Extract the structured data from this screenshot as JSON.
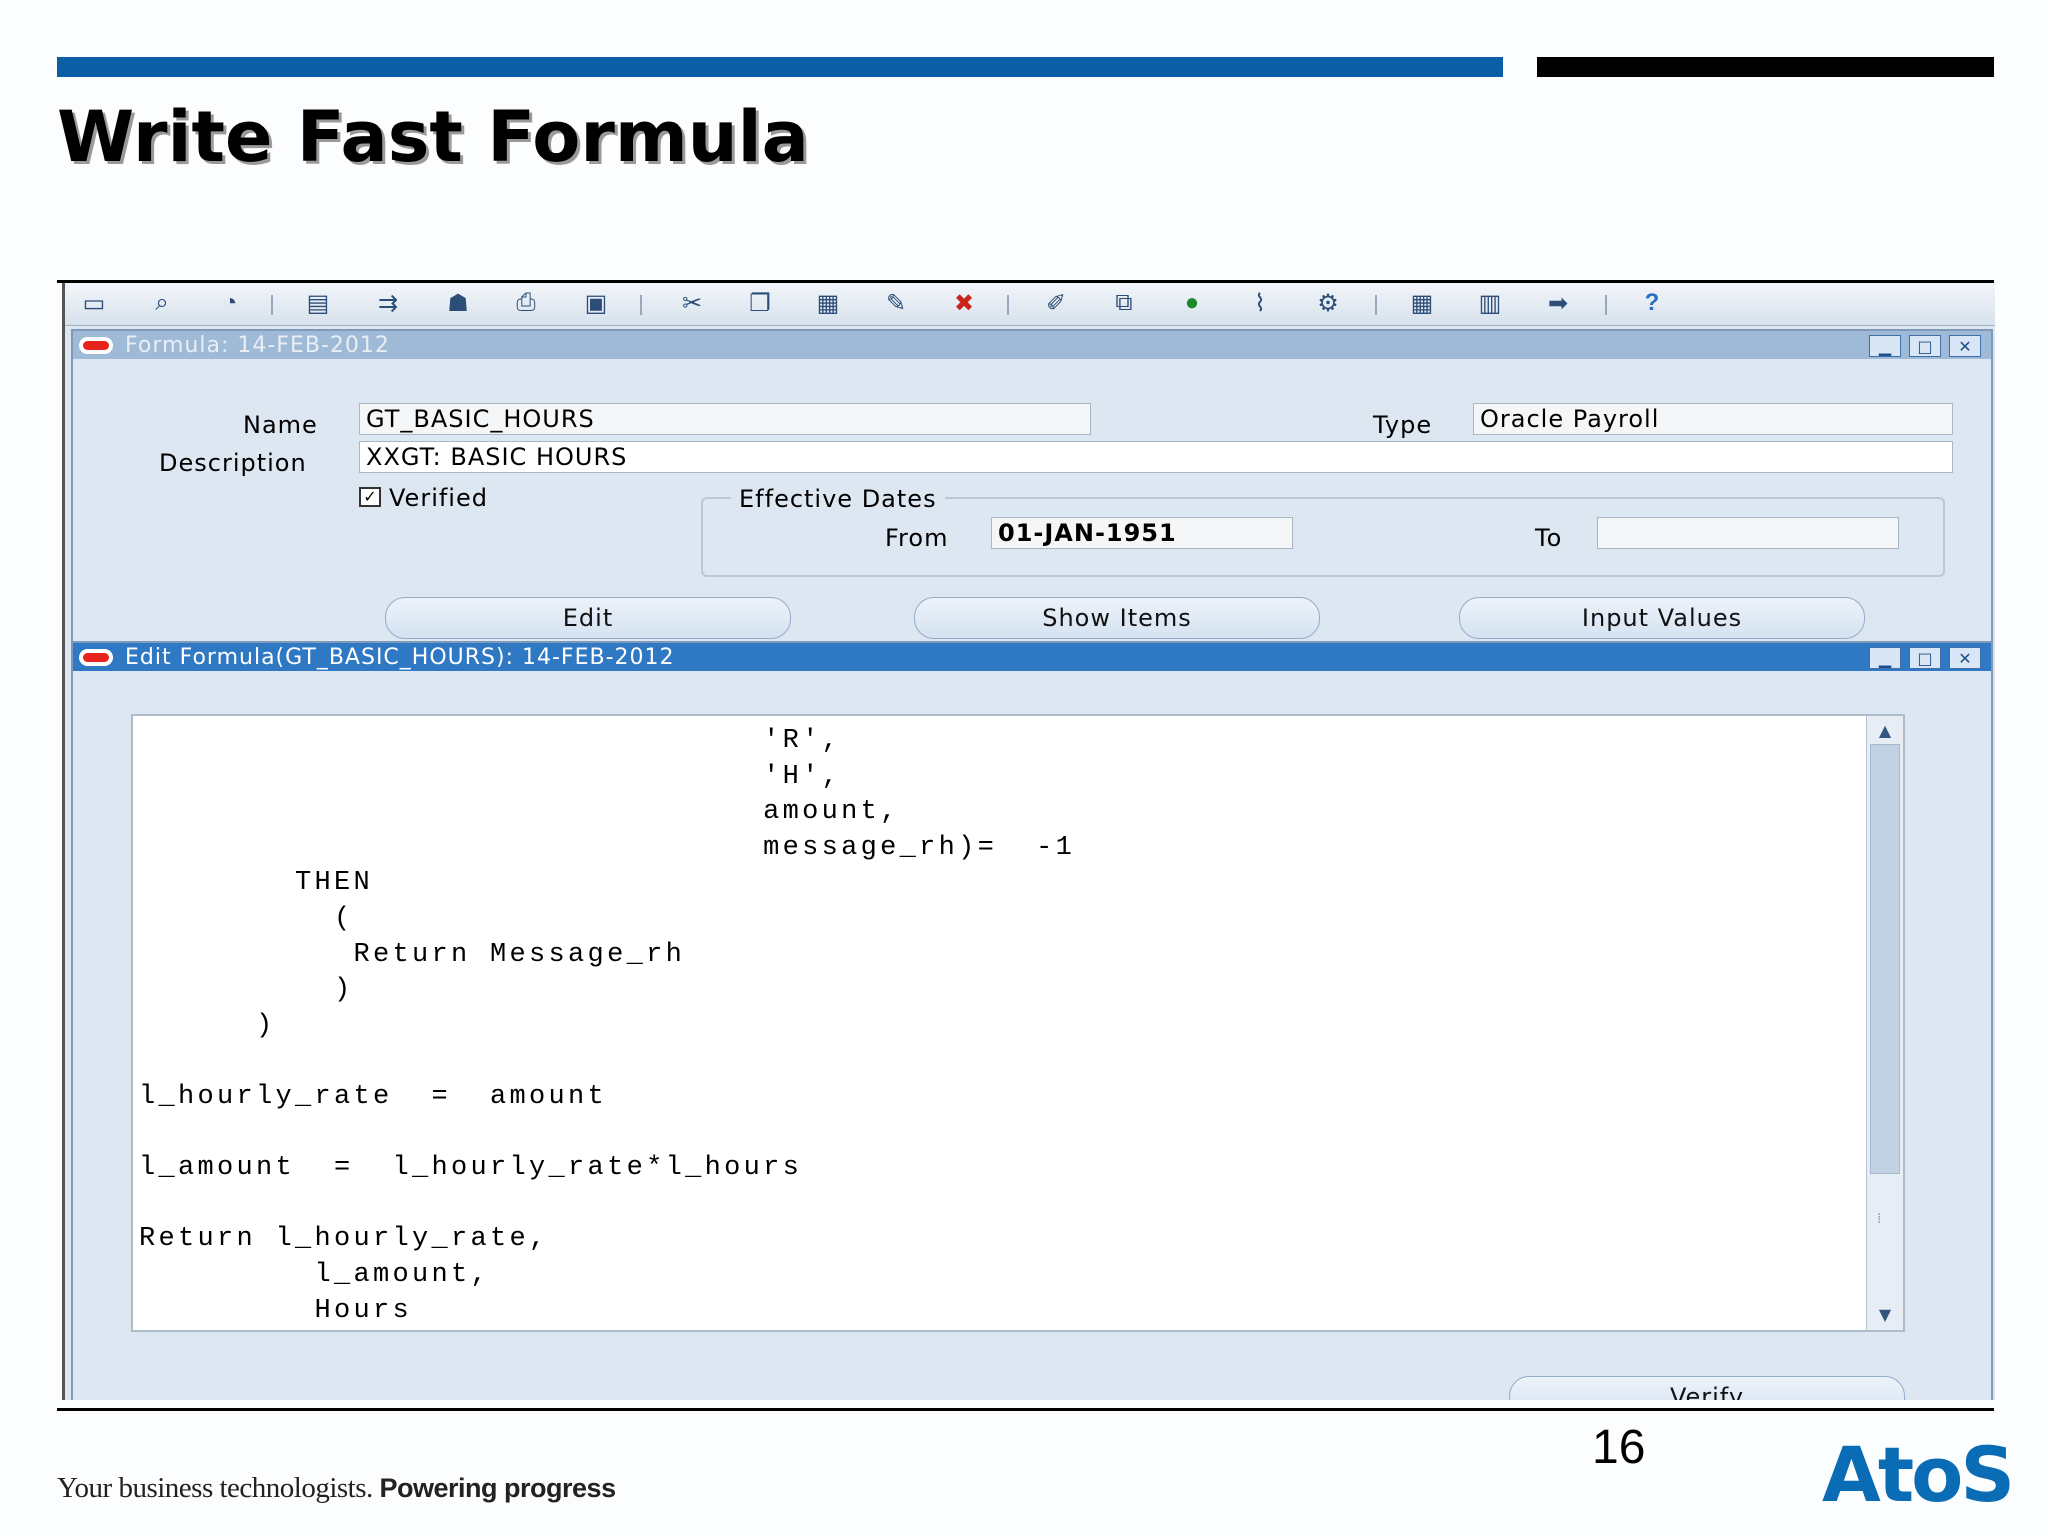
{
  "slide": {
    "title": "Write Fast Formula",
    "page_number": "16",
    "tagline_prefix": "Your business technologists.",
    "tagline_suffix": "Powering progress",
    "logo": "AtoS",
    "colors": {
      "accent_blue": "#0a5ea4",
      "logo_blue": "#0b6cb6"
    }
  },
  "toolbar": {
    "icons": [
      "new-record-icon",
      "find-icon",
      "navigator-icon",
      "save-icon",
      "next-step-icon",
      "switch-responsibility-icon",
      "print-icon",
      "close-form-icon",
      "cut-icon",
      "copy-icon",
      "paste-icon",
      "clear-record-icon",
      "delete-record-icon",
      "edit-field-icon",
      "zoom-icon",
      "translations-icon",
      "attachments-icon",
      "folder-tools-icon",
      "calendar-icon",
      "workflow-icon",
      "window-help-icon",
      "help-icon"
    ]
  },
  "formula_window": {
    "title": "Formula: 14-FEB-2012",
    "name_label": "Name",
    "name_value": "GT_BASIC_HOURS",
    "type_label": "Type",
    "type_value": "Oracle Payroll",
    "description_label": "Description",
    "description_value": "XXGT: BASIC HOURS",
    "verified_label": "Verified",
    "verified_checked": true,
    "effective_dates_label": "Effective Dates",
    "from_label": "From",
    "from_value": "01-JAN-1951",
    "to_label": "To",
    "to_value": "",
    "buttons": {
      "edit": "Edit",
      "show_items": "Show Items",
      "input_values": "Input Values"
    }
  },
  "edit_window": {
    "title": "Edit Formula(GT_BASIC_HOURS): 14-FEB-2012",
    "code": "                                'R',\n                                'H',\n                                amount,\n                                message_rh)=  -1\n        THEN\n          (\n           Return Message_rh\n          )\n      )\n\nl_hourly_rate  =  amount\n\nl_amount  =  l_hourly_rate*l_hours\n\nReturn l_hourly_rate,\n         l_amount,\n         Hours",
    "verify_button": "Verify"
  }
}
